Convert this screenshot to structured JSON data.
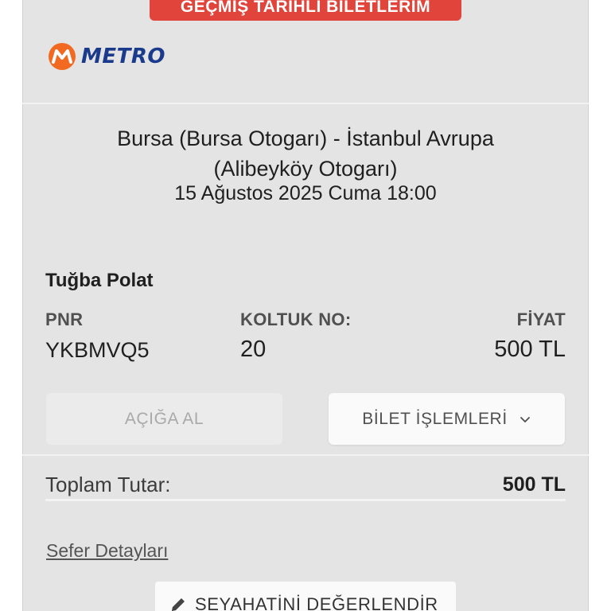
{
  "header": {
    "badge_label": "GEÇMİŞ TARİHLİ BİLETLERİM",
    "logo_text": "METRO",
    "colors": {
      "badge": "#e0443a",
      "logo_mark": "#f26a21",
      "logo_text": "#1a3a8c"
    }
  },
  "trip": {
    "route_line1": "Bursa (Bursa Otogarı) - İstanbul Avrupa",
    "route_line2": "(Alibeyköy Otogarı)",
    "datetime": "15 Ağustos 2025 Cuma 18:00"
  },
  "ticket": {
    "passenger_name": "Tuğba Polat",
    "pnr_label": "PNR",
    "pnr_value": "YKBMVQ5",
    "seat_label": "KOLTUK NO:",
    "seat_value": "20",
    "price_label": "FİYAT",
    "price_value": "500 TL"
  },
  "actions": {
    "open_ticket_label": "AÇIĞA AL",
    "ticket_operations_label": "BİLET İŞLEMLERİ",
    "ticket_operations_icon": "chevron-down-icon"
  },
  "summary": {
    "total_label": "Toplam Tutar:",
    "total_value": "500 TL"
  },
  "links": {
    "trip_details_label": "Sefer Detayları"
  },
  "rate": {
    "label": "SEYAHATİNİ DEĞERLENDİR",
    "icon": "pencil-icon"
  }
}
